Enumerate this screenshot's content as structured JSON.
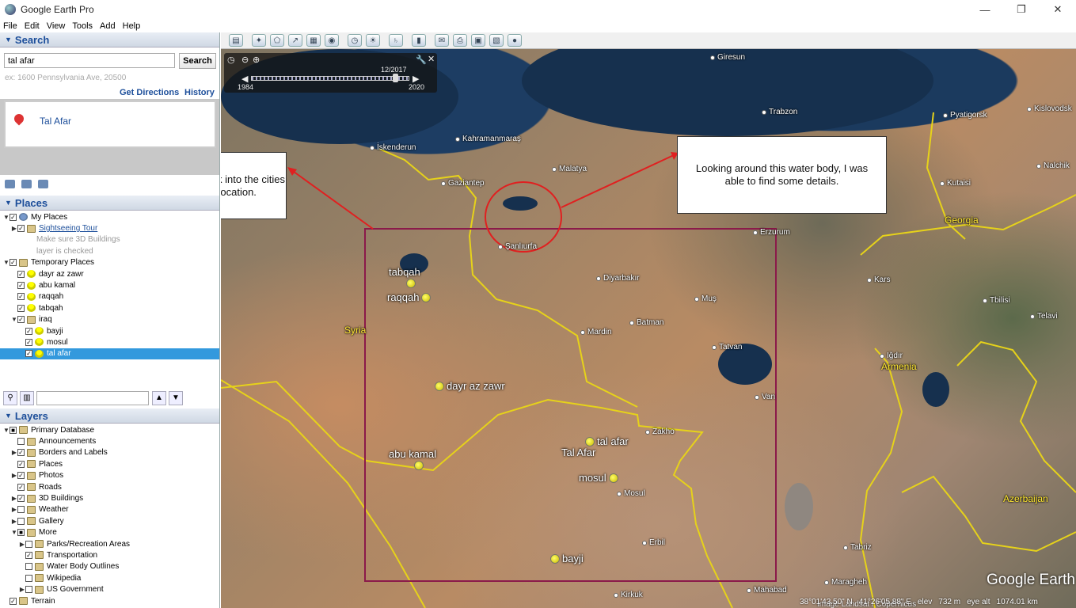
{
  "window": {
    "title": "Google Earth Pro",
    "minimize": "—",
    "maximize": "❐",
    "close": "✕"
  },
  "menu": [
    "File",
    "Edit",
    "View",
    "Tools",
    "Add",
    "Help"
  ],
  "search": {
    "header": "Search",
    "input_value": "tal afar",
    "button": "Search",
    "hint": "ex: 1600 Pennsylvania Ave, 20500",
    "get_directions": "Get Directions",
    "history": "History",
    "result": "Tal Afar"
  },
  "places": {
    "header": "Places",
    "items": [
      {
        "label": "My Places",
        "indent": 0,
        "exp": "▼",
        "checked": true,
        "icon": "globe"
      },
      {
        "label": "Sightseeing Tour",
        "indent": 1,
        "exp": "▶",
        "checked": true,
        "icon": "folder",
        "link": true
      },
      {
        "label": "Make sure 3D Buildings",
        "indent": 2,
        "exp": "",
        "checked": null,
        "icon": "",
        "grey": true
      },
      {
        "label": "layer is checked",
        "indent": 2,
        "exp": "",
        "checked": null,
        "icon": "",
        "grey": true
      },
      {
        "label": "Temporary Places",
        "indent": 0,
        "exp": "▼",
        "checked": true,
        "icon": "folder"
      },
      {
        "label": "dayr az zawr",
        "indent": 1,
        "exp": "",
        "checked": true,
        "icon": "pin"
      },
      {
        "label": "abu kamal",
        "indent": 1,
        "exp": "",
        "checked": true,
        "icon": "pin"
      },
      {
        "label": "raqqah",
        "indent": 1,
        "exp": "",
        "checked": true,
        "icon": "pin"
      },
      {
        "label": "tabqah",
        "indent": 1,
        "exp": "",
        "checked": true,
        "icon": "pin"
      },
      {
        "label": "iraq",
        "indent": 1,
        "exp": "▼",
        "checked": true,
        "icon": "folder"
      },
      {
        "label": "bayji",
        "indent": 2,
        "exp": "",
        "checked": true,
        "icon": "pin"
      },
      {
        "label": "mosul",
        "indent": 2,
        "exp": "",
        "checked": true,
        "icon": "pin"
      },
      {
        "label": "tal afar",
        "indent": 2,
        "exp": "",
        "checked": true,
        "icon": "pin",
        "selected": true
      }
    ]
  },
  "layers": {
    "header": "Layers",
    "items": [
      {
        "label": "Primary Database",
        "indent": 0,
        "exp": "▼",
        "checked": "partial"
      },
      {
        "label": "Announcements",
        "indent": 1,
        "exp": "",
        "checked": false
      },
      {
        "label": "Borders and Labels",
        "indent": 1,
        "exp": "▶",
        "checked": true
      },
      {
        "label": "Places",
        "indent": 1,
        "exp": "",
        "checked": true
      },
      {
        "label": "Photos",
        "indent": 1,
        "exp": "▶",
        "checked": true
      },
      {
        "label": "Roads",
        "indent": 1,
        "exp": "",
        "checked": true
      },
      {
        "label": "3D Buildings",
        "indent": 1,
        "exp": "▶",
        "checked": true
      },
      {
        "label": "Weather",
        "indent": 1,
        "exp": "▶",
        "checked": false
      },
      {
        "label": "Gallery",
        "indent": 1,
        "exp": "▶",
        "checked": false
      },
      {
        "label": "More",
        "indent": 1,
        "exp": "▼",
        "checked": "partial"
      },
      {
        "label": "Parks/Recreation Areas",
        "indent": 2,
        "exp": "▶",
        "checked": false
      },
      {
        "label": "Transportation",
        "indent": 2,
        "exp": "",
        "checked": true
      },
      {
        "label": "Water Body Outlines",
        "indent": 2,
        "exp": "",
        "checked": false
      },
      {
        "label": "Wikipedia",
        "indent": 2,
        "exp": "",
        "checked": false
      },
      {
        "label": "US Government",
        "indent": 2,
        "exp": "▶",
        "checked": false
      },
      {
        "label": "Terrain",
        "indent": 0,
        "exp": "",
        "checked": true
      }
    ]
  },
  "timeslider": {
    "date": "12/2017",
    "start": "1984",
    "end": "2020"
  },
  "annotations": {
    "left_note": "Marked them all and tried to look into the cities but none ressembled our location.",
    "right_note": "Looking around this water body, I was able to find some details."
  },
  "map_labels": {
    "cities": [
      "Giresun",
      "Trabzon",
      "Kahramanmaraş",
      "İskenderun",
      "Malatya",
      "Gaziantep",
      "Şanlıurfa",
      "Diyarbakır",
      "Muş",
      "Batman",
      "Mardin",
      "Tatvan",
      "Van",
      "Erzurum",
      "Kars",
      "Iğdır",
      "Zakho",
      "Mosul",
      "Erbil",
      "Tabriz",
      "Maragheh",
      "Mahabad",
      "Kirkuk",
      "Tbilisi",
      "Kutaisi",
      "Telavi",
      "Nalchik",
      "Kislovodsk",
      "Pyatigorsk"
    ],
    "countries": [
      "Syria",
      "Georgia",
      "Armenia",
      "Azerbaijan"
    ],
    "marks": [
      "tabqah",
      "raqqah",
      "dayr az zawr",
      "abu kamal",
      "tal afar",
      "Tal Afar",
      "mosul",
      "bayji"
    ]
  },
  "status": {
    "lat": "38°01'43.50\" N",
    "lon": "41°26'05.88\" E",
    "elev_label": "elev",
    "elev": "732 m",
    "eye_label": "eye alt",
    "eye": "1074.01 km"
  },
  "imagery_credit": "Image Landsat / Copernicus",
  "logo": "Google Earth",
  "colors": {
    "accent": "#1c4e9a",
    "selection": "#3399dd",
    "box": "#8b1a4a",
    "arrow": "#e02020",
    "border": "#e6d21a"
  }
}
